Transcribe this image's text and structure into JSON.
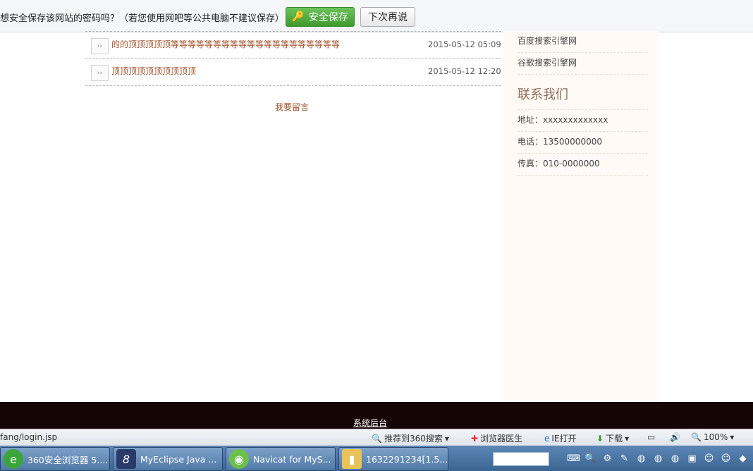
{
  "password_bar": {
    "prompt": "想安全保存该网站的密码吗？（若您使用网吧等公共电脑不建议保存）",
    "save_label": "安全保存",
    "later_label": "下次再说"
  },
  "messages": [
    {
      "title": "的的顶顶顶顶顶等等等等等等等等等等等等等等等等等等等等",
      "date": "2015-05-12 05:09"
    },
    {
      "title": "顶顶顶顶顶顶顶顶顶顶",
      "date": "2015-05-12 12:20"
    }
  ],
  "leave_message_label": "我要留言",
  "sidebar": {
    "links": [
      "百度搜索引擎网",
      "谷歌搜索引擎网"
    ],
    "contact_heading": "联系我们",
    "contact": [
      "地址：xxxxxxxxxxxxx",
      "电话：13500000000",
      "传真：010-0000000"
    ]
  },
  "footer": {
    "admin_link": "系统后台"
  },
  "status_bar": {
    "url": "fang/login.jsp",
    "recommend": "推荐到360搜索",
    "doctor": "浏览器医生",
    "ie_open": "IE打开",
    "download": "下载",
    "zoom": "100%"
  },
  "taskbar": {
    "items": [
      {
        "label": "360安全浏览器 5....",
        "icon": "browser-360-icon",
        "color": "#3aa63a"
      },
      {
        "label": "MyEclipse Java ...",
        "icon": "myeclipse-icon",
        "color": "#2a3a6a"
      },
      {
        "label": "Navicat for MyS...",
        "icon": "navicat-icon",
        "color": "#6cc04a"
      },
      {
        "label": "1632291234[1.5...",
        "icon": "folder-icon",
        "color": "#e8c25a"
      }
    ]
  }
}
